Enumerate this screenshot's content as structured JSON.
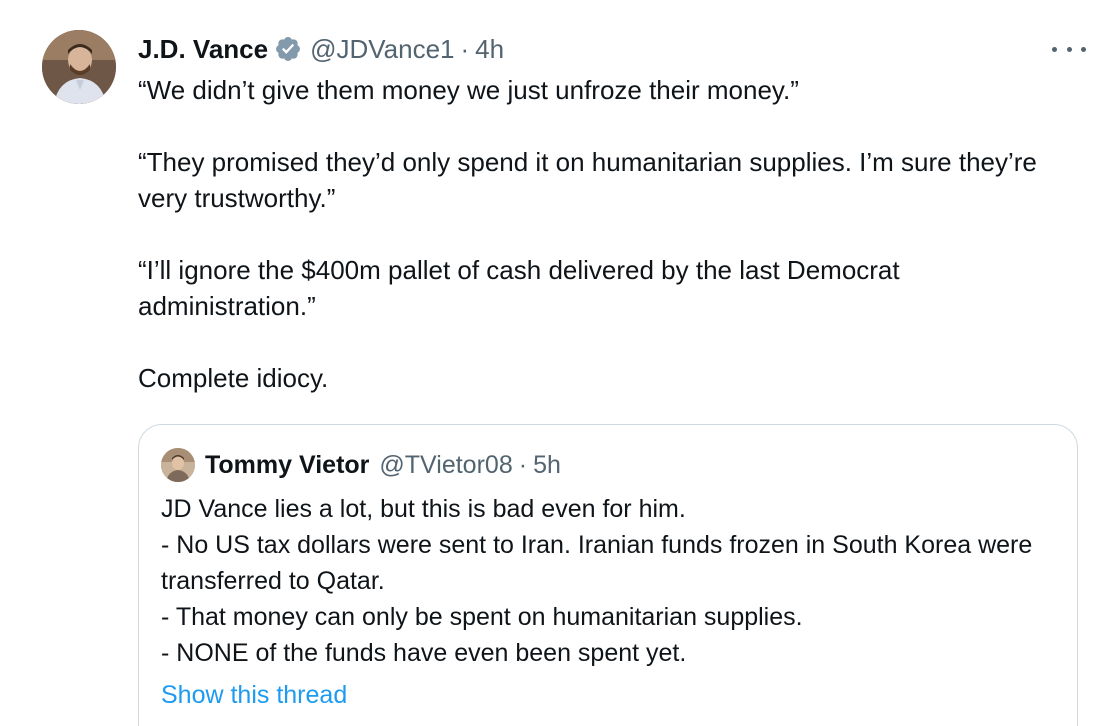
{
  "tweet": {
    "author_name": "J.D. Vance",
    "handle": "@JDVance1",
    "separator": "·",
    "time": "4h",
    "verified_icon": "verified-badge-icon",
    "paragraphs": [
      "“We didn’t give them money we just unfroze their money.”",
      "“They promised they’d only spend it on humanitarian supplies. I’m sure they’re very trustworthy.”",
      "“I’ll ignore the $400m pallet of cash delivered by the last Democrat administration.”",
      "Complete idiocy."
    ]
  },
  "quoted_tweet": {
    "author_name": "Tommy Vietor",
    "handle": "@TVietor08",
    "separator": "·",
    "time": "5h",
    "lines": [
      "JD Vance lies a lot, but this is bad even for him.",
      "- No US tax dollars were sent to Iran. Iranian funds frozen in South Korea were transferred to Qatar.",
      "- That money can only be spent on humanitarian supplies.",
      "- NONE of the funds have even been spent yet."
    ],
    "show_thread_label": "Show this thread"
  },
  "colors": {
    "text_primary": "#0f1419",
    "text_secondary": "#536471",
    "link": "#1d9bf0",
    "verified_badge": "#829aab",
    "border": "#cfd9de"
  }
}
